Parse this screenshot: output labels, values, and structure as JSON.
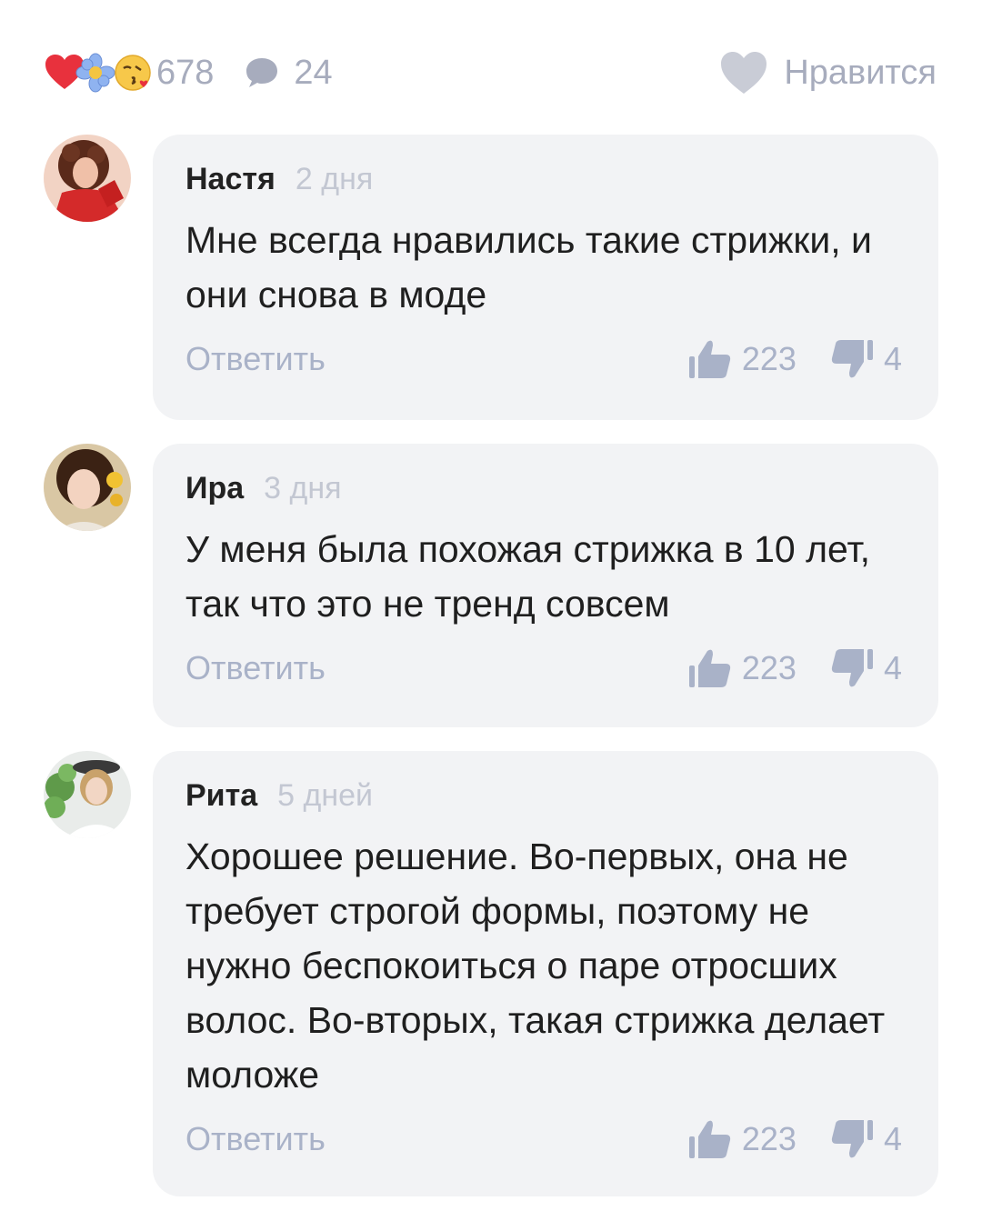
{
  "header": {
    "reactions_count": "678",
    "comments_count": "24",
    "like_label": "Нравится",
    "reaction_icons": [
      "heart-icon",
      "flower-icon",
      "kiss-emoji-icon"
    ]
  },
  "colors": {
    "bubble_bg": "#f2f3f5",
    "muted": "#a9b2c8",
    "heart_red": "#e8313d"
  },
  "comments": [
    {
      "author": "Настя",
      "time": "2 дня",
      "text": "Мне всегда нравились такие стрижки, и они снова в моде",
      "reply_label": "Ответить",
      "likes": "223",
      "dislikes": "4"
    },
    {
      "author": "Ира",
      "time": "3 дня",
      "text": "У меня была похожая стрижка в 10 лет, так что это не тренд совсем",
      "reply_label": "Ответить",
      "likes": "223",
      "dislikes": "4"
    },
    {
      "author": "Рита",
      "time": "5 дней",
      "text": "Хорошее решение. Во-первых, она не требует строгой формы, поэтому не нужно беспокоиться о паре отросших волос.  Во-вторых, такая стрижка делает моложе",
      "reply_label": "Ответить",
      "likes": "223",
      "dislikes": "4"
    }
  ]
}
